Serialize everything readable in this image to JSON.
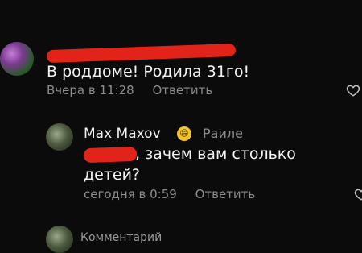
{
  "comment1": {
    "text": "В роддоме! Родила 31го!",
    "time": "Вчера в 11:28",
    "reply": "Ответить"
  },
  "comment2": {
    "username": "Max Maxov",
    "emoji": "😁",
    "author_label": "Раиле",
    "text_line1": ", зачем вам столько",
    "text_line2": "детей?",
    "time": "сегодня в 0:59",
    "reply": "Ответить"
  },
  "comment3": {
    "partial": "Комментарий"
  },
  "colors": {
    "background": "#0b0b0b",
    "redaction": "#e2231a",
    "meta_text": "#8c8c8c"
  },
  "icons": {
    "like": "heart-icon"
  }
}
